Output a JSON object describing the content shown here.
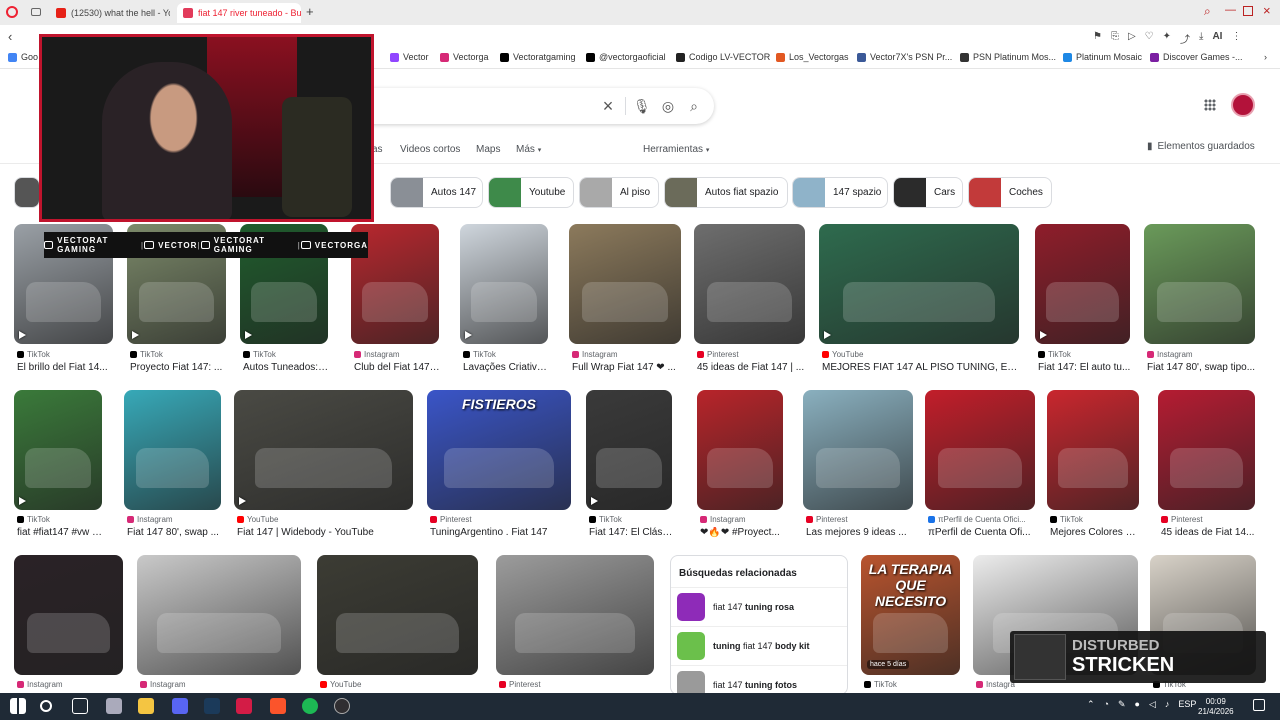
{
  "tabs": [
    {
      "title": "(12530) what the hell - Yo",
      "color": "#e62117"
    },
    {
      "title": "fiat 147 river tuneado - Bu",
      "color": "#e23b5b"
    }
  ],
  "toolbar": {
    "ai_label": "AI"
  },
  "bookmarks": [
    {
      "label": "Goo",
      "color": "#4285f4"
    },
    {
      "label": "Vector",
      "color": "#9146ff"
    },
    {
      "label": "Vectorga",
      "color": "#d62976"
    },
    {
      "label": "Vectoratgaming",
      "color": "#000000"
    },
    {
      "label": "@vectorgaoficial",
      "color": "#000000"
    },
    {
      "label": "Codigo LV-VECTOR",
      "color": "#222222"
    },
    {
      "label": "Los_Vectorgas",
      "color": "#e25822"
    },
    {
      "label": "Vector7X's PSN Pr...",
      "color": "#3b5998"
    },
    {
      "label": "PSN Platinum Mos...",
      "color": "#333333"
    },
    {
      "label": "Platinum Mosaic",
      "color": "#1e88e5"
    },
    {
      "label": "Discover Games -...",
      "color": "#7b1fa2"
    }
  ],
  "google": {
    "nav": [
      "as",
      "Videos cortos",
      "Maps",
      "Más",
      "Herramientas"
    ],
    "saved": "Elementos guardados"
  },
  "chips": [
    {
      "label": "Autos 147",
      "color": "#8a8f96"
    },
    {
      "label": "Youtube",
      "color": "#3e8a4a"
    },
    {
      "label": "Al piso",
      "color": "#a9a9a9"
    },
    {
      "label": "Autos fiat spazio",
      "color": "#6b6b5a"
    },
    {
      "label": "147 spazio",
      "color": "#8fb3c9"
    },
    {
      "label": "Cars",
      "color": "#2b2b2b"
    },
    {
      "label": "Coches",
      "color": "#c23a3a"
    }
  ],
  "row1": [
    {
      "source": "TikTok",
      "caption": "El brillo del Fiat 14...",
      "color": "#9aa0a6",
      "fav": "#000",
      "video": true
    },
    {
      "source": "TikTok",
      "caption": "Proyecto Fiat 147: ...",
      "color": "#7c8a6a",
      "fav": "#000",
      "video": true
    },
    {
      "source": "TikTok",
      "caption": "Autos Tuneados: F...",
      "color": "#1f5d2d",
      "fav": "#000",
      "video": true
    },
    {
      "source": "Instagram",
      "caption": "Club del Fiat 147 d...",
      "color": "#b8272e",
      "fav": "#d62976",
      "video": false
    },
    {
      "source": "TikTok",
      "caption": "Lavações Criativas...",
      "color": "#cfd6dd",
      "fav": "#000",
      "video": true
    },
    {
      "source": "Instagram",
      "caption": "Full Wrap Fiat 147 ❤ ...",
      "color": "#8c7a5c",
      "fav": "#d62976",
      "video": false
    },
    {
      "source": "Pinterest",
      "caption": "45 ideas de Fiat 147 | ...",
      "color": "#6e6e6e",
      "fav": "#e60023",
      "video": false
    },
    {
      "source": "YouTube",
      "caption": "MEJORES FIAT 147 AL PISO TUNING, EN...",
      "color": "#2e6b4e",
      "fav": "#ff0000",
      "video": true
    },
    {
      "source": "TikTok",
      "caption": "Fiat 147: El auto tu...",
      "color": "#8f1d2a",
      "fav": "#000",
      "video": true
    },
    {
      "source": "Instagram",
      "caption": "Fiat 147 80', swap tipo...",
      "color": "#6a9a5a",
      "fav": "#d62976",
      "video": false
    }
  ],
  "row2": [
    {
      "source": "TikTok",
      "caption": "fiat #fiat147 #vw #t...",
      "color": "#3a7a3a",
      "fav": "#000",
      "video": true
    },
    {
      "source": "Instagram",
      "caption": "Fiat 147 80', swap ...",
      "color": "#37a9b8",
      "fav": "#d62976",
      "video": false
    },
    {
      "source": "YouTube",
      "caption": "Fiat 147 | Widebody - YouTube",
      "color": "#4a4a44",
      "fav": "#ff0000",
      "video": true
    },
    {
      "source": "Pinterest",
      "caption": "TuningArgentino . Fiat 147",
      "color": "#3a55c8",
      "fav": "#e60023",
      "video": false,
      "overlay": "FISTIEROS"
    },
    {
      "source": "TikTok",
      "caption": "Fiat 147: El Clásic...",
      "color": "#3a3a3a",
      "fav": "#000",
      "video": true
    },
    {
      "source": "Instagram",
      "caption": "❤🔥❤ #Proyect...",
      "color": "#b8242a",
      "fav": "#d62976",
      "video": false
    },
    {
      "source": "Pinterest",
      "caption": "Las mejores 9 ideas ...",
      "color": "#8ab0bf",
      "fav": "#e60023",
      "video": false
    },
    {
      "source": "πPerfil de Cuenta Ofici...",
      "caption": "πPerfil de Cuenta Ofi...",
      "color": "#c21e2a",
      "fav": "#1a73e8",
      "video": false
    },
    {
      "source": "TikTok",
      "caption": "Mejores Colores Fi...",
      "color": "#c9262e",
      "fav": "#000",
      "video": false
    },
    {
      "source": "Pinterest",
      "caption": "45 ideas de Fiat 14...",
      "color": "#b51c32",
      "fav": "#e60023",
      "video": false
    }
  ],
  "row3": [
    {
      "source": "Instagram",
      "color": "#2a2226",
      "fav": "#d62976"
    },
    {
      "source": "Instagram",
      "color": "#c9c9c9",
      "fav": "#d62976"
    },
    {
      "source": "YouTube",
      "color": "#3c3c34",
      "fav": "#ff0000"
    },
    {
      "source": "Pinterest",
      "color": "#9c9c9c",
      "fav": "#e60023"
    },
    {
      "source": "TikTok",
      "color": "#b9542e",
      "fav": "#000",
      "overlay": "LA TERAPIA QUE NECESITO",
      "badge": "hace 5 días"
    },
    {
      "source": "Instagra",
      "color": "#ececec",
      "fav": "#d62976"
    },
    {
      "source": "TikTok",
      "color": "#d8d2c8",
      "fav": "#000"
    }
  ],
  "related": {
    "heading": "Búsquedas relacionadas",
    "items": [
      {
        "pre": "fiat 147 ",
        "bold": "tuning rosa",
        "post": "",
        "color": "#8e2bb8"
      },
      {
        "pre": "",
        "bold": "tuning",
        "post": " fiat 147 body kit",
        "bold2": "body kit",
        "color": "#6bc04b"
      },
      {
        "pre": "fiat 147 ",
        "bold": "tuning fotos",
        "post": "",
        "color": "#9a9a9a"
      }
    ]
  },
  "stream": {
    "social": [
      "VECTORAT GAMING",
      "VECTOR",
      "VECTORAT GAMING",
      "VECTORGA"
    ]
  },
  "now_playing": {
    "artist": "DISTURBED",
    "title": "STRICKEN"
  },
  "taskbar": {
    "lang": "ESP",
    "time": "00:09",
    "date": "21/4/2026"
  }
}
